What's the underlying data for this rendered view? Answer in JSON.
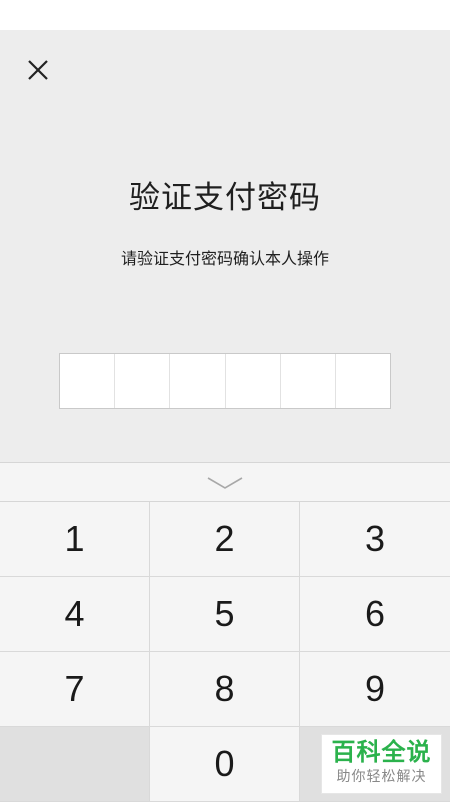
{
  "header": {
    "close_icon": "close-icon"
  },
  "main": {
    "title": "验证支付密码",
    "subtitle": "请验证支付密码确认本人操作",
    "pin_length": 6
  },
  "keyboard": {
    "toggle_icon": "chevron-down-icon",
    "keys": [
      "1",
      "2",
      "3",
      "4",
      "5",
      "6",
      "7",
      "8",
      "9",
      "",
      "0",
      "delete"
    ]
  },
  "watermark": {
    "main": "百科全说",
    "sub": "助你轻松解决"
  },
  "colors": {
    "background": "#ededed",
    "keyboard": "#f5f5f5",
    "watermark_green": "#2bb24c"
  }
}
